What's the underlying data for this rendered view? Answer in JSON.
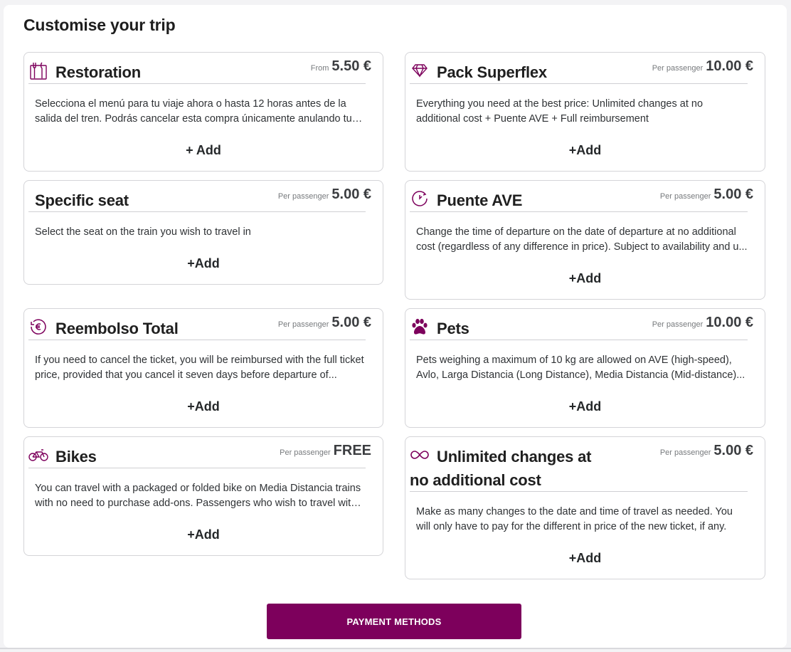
{
  "page": {
    "title": "Customise your trip",
    "accent_color": "#7d005c",
    "payment_button": "PAYMENT METHODS"
  },
  "cards": [
    {
      "icon": "restaurant-icon",
      "title": "Restoration",
      "price_label": "From",
      "price": "5.50 €",
      "description": "Selecciona el menú para tu viaje ahora o hasta 12 horas antes de la salida del tren. Podrás cancelar esta compra únicamente anulando tu billete.",
      "add_label": "+ Add"
    },
    {
      "icon": "diamond-icon",
      "title": "Pack Superflex",
      "price_label": "Per passenger",
      "price": "10.00 €",
      "description": "Everything you need at the best price: Unlimited changes at no additional cost + Puente AVE + Full reimbursement",
      "add_label": "+Add"
    },
    {
      "icon": "",
      "title": "Specific seat",
      "price_label": "Per passenger",
      "price": "5.00 €",
      "description": "Select the seat on the train you wish to travel in",
      "add_label": "+Add"
    },
    {
      "icon": "clock-icon",
      "title": "Puente AVE",
      "price_label": "Per passenger",
      "price": "5.00 €",
      "description": "Change the time of departure on the date of departure at no additional cost (regardless of any difference in price). Subject to availability and u...",
      "add_label": "+Add"
    },
    {
      "icon": "euro-refund-icon",
      "title": "Reembolso Total",
      "price_label": "Per passenger",
      "price": "5.00 €",
      "description": "If you need to cancel the ticket, you will be reimbursed with the full ticket price, provided that you cancel it seven days before departure of...",
      "add_label": "+Add"
    },
    {
      "icon": "paw-icon",
      "title": "Pets",
      "price_label": "Per passenger",
      "price": "10.00 €",
      "description": "Pets weighing a maximum of 10 kg are allowed on AVE (high-speed), Avlo, Larga Distancia (Long Distance), Media Distancia (Mid-distance)...",
      "add_label": "+Add"
    },
    {
      "icon": "bike-icon",
      "title": "Bikes",
      "price_label": "Per passenger",
      "price": "FREE",
      "description": "You can travel with a packaged or folded bike on Media Distancia trains with no need to purchase add-ons. Passengers who wish to travel with ...",
      "add_label": "+Add"
    },
    {
      "icon": "infinity-icon",
      "title": "Unlimited changes at no additional cost",
      "price_label": "Per passenger",
      "price": "5.00 €",
      "description": "Make as many changes to the date and time of travel as needed. You will only have to pay for the different in price of the new ticket, if any.",
      "add_label": "+Add"
    }
  ]
}
